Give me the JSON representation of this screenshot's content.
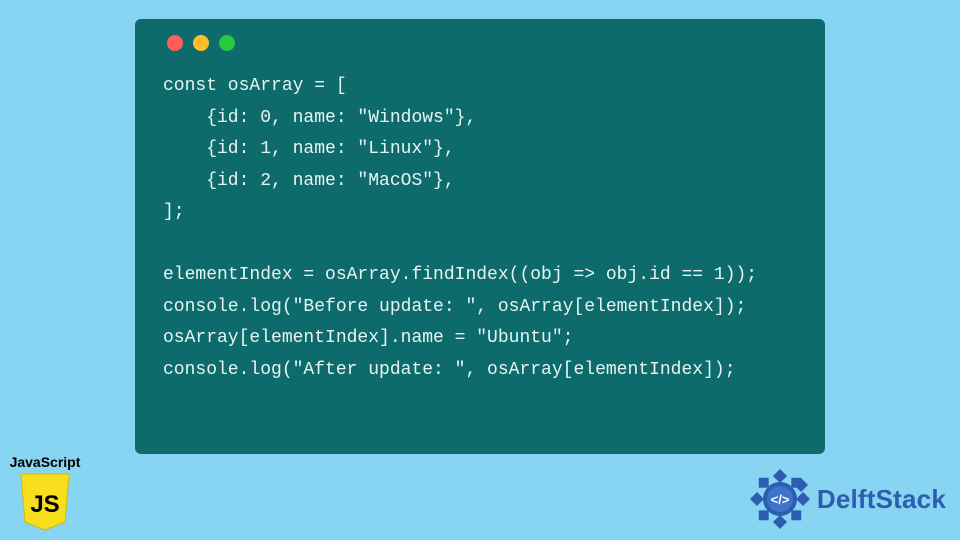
{
  "code_window": {
    "lines": [
      "const osArray = [",
      "    {id: 0, name: \"Windows\"},",
      "    {id: 1, name: \"Linux\"},",
      "    {id: 2, name: \"MacOS\"},",
      "];",
      "",
      "elementIndex = osArray.findIndex((obj => obj.id == 1));",
      "console.log(\"Before update: \", osArray[elementIndex]);",
      "osArray[elementIndex].name = \"Ubuntu\";",
      "console.log(\"After update: \", osArray[elementIndex]);"
    ]
  },
  "js_badge": {
    "label": "JavaScript",
    "shield_text": "JS"
  },
  "delft_logo": {
    "brand_text": "DelftStack",
    "icon_glyph": "</>"
  },
  "colors": {
    "page_bg": "#87d5f2",
    "window_bg": "#0e6b6b",
    "code_text": "#e8f4f4",
    "js_yellow": "#f7df1e",
    "delft_blue": "#2c5db1"
  }
}
